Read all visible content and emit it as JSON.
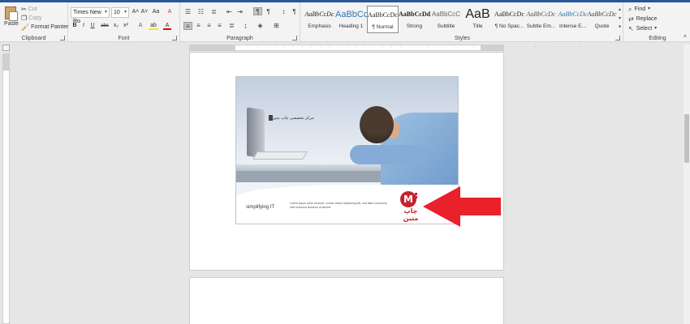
{
  "clipboard": {
    "group_label": "Clipboard",
    "paste": "Paste",
    "cut": "Cut",
    "copy": "Copy",
    "format_painter": "Format Painter"
  },
  "font": {
    "group_label": "Font",
    "family": "Times New Ro",
    "size": "10",
    "grow": "A˄",
    "shrink": "A˅",
    "change_case": "Aa",
    "clear_formatting": "A",
    "bold": "B",
    "italic": "I",
    "underline": "U",
    "strikethrough": "abc",
    "subscript": "x₂",
    "superscript": "x²",
    "text_effects": "A",
    "highlight": "ab",
    "font_color": "A"
  },
  "paragraph": {
    "group_label": "Paragraph",
    "pilcrow": "¶"
  },
  "styles": {
    "group_label": "Styles",
    "items": [
      {
        "preview": "AaBbCcDc",
        "name": "Emphasis"
      },
      {
        "preview": "AaBbCc",
        "name": "Heading 1"
      },
      {
        "preview": "AaBbCcDc",
        "name": "¶ Normal"
      },
      {
        "preview": "AaBbCcDd",
        "name": "Strong"
      },
      {
        "preview": "AaBbCcC",
        "name": "Subtitle"
      },
      {
        "preview": "AaB",
        "name": "Title"
      },
      {
        "preview": "AaBbCcDc",
        "name": "¶ No Spac..."
      },
      {
        "preview": "AaBbCcDc",
        "name": "Subtle Em..."
      },
      {
        "preview": "AaBbCcDc",
        "name": "Intense E..."
      },
      {
        "preview": "AaBbCcDc",
        "name": "Quote"
      }
    ]
  },
  "editing": {
    "group_label": "Editing",
    "find": "Find",
    "replace": "Replace",
    "select": "Select"
  },
  "document": {
    "image": {
      "caption_rtl": "مرکز تخصصی چاپ متین",
      "tagline": "simplifying IT",
      "lorem": "Lorem ipsum dolor sit amet, consec tetuer adipiscing elit, sed diam nonummy nibh euismod tincidunt ut laoreet",
      "logo_text": "چاپ متین"
    }
  },
  "colors": {
    "accent": "#2b579a",
    "arrow": "#e8212a",
    "logo": "#c4222f"
  }
}
